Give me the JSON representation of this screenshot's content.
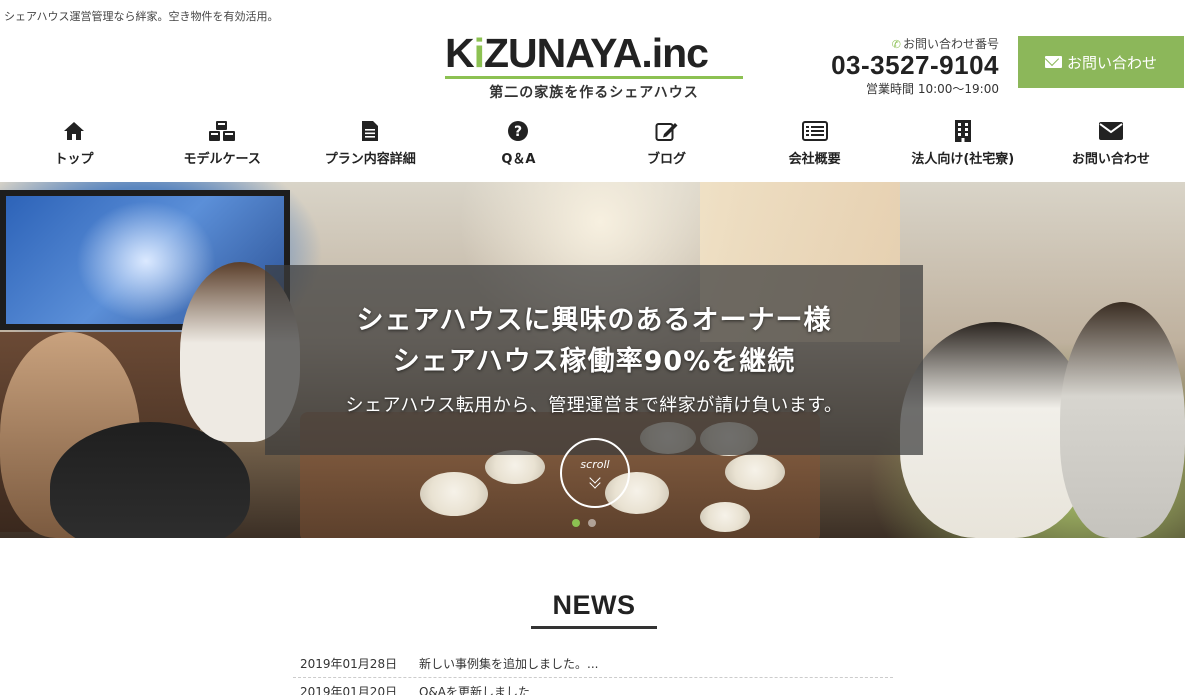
{
  "header": {
    "tagline": "シェアハウス運営管理なら絆家。空き物件を有効活用。",
    "logo_text_pre": "K",
    "logo_text_accent": "i",
    "logo_text_post": "ZUNAYA.inc",
    "logo_subtitle": "第二の家族を作るシェアハウス",
    "contact_label": "お問い合わせ番号",
    "phone": "03-3527-9104",
    "hours": "営業時間 10:00〜19:00",
    "cta_label": "お問い合わせ",
    "brand_color": "#8cb75a"
  },
  "nav": {
    "items": [
      {
        "label": "トップ",
        "icon": "home-icon"
      },
      {
        "label": "モデルケース",
        "icon": "cubes-icon"
      },
      {
        "label": "プラン内容詳細",
        "icon": "document-icon"
      },
      {
        "label": "Q＆A",
        "icon": "question-circle-icon"
      },
      {
        "label": "ブログ",
        "icon": "edit-icon"
      },
      {
        "label": "会社概要",
        "icon": "list-card-icon"
      },
      {
        "label": "法人向け(社宅寮)",
        "icon": "building-icon"
      },
      {
        "label": "お問い合わせ",
        "icon": "envelope-icon"
      }
    ]
  },
  "hero": {
    "title_line1": "シェアハウスに興味のあるオーナー様",
    "title_line2": "シェアハウス稼働率90%を継続",
    "subtitle": "シェアハウス転用から、管理運営まで絆家が請け負います。",
    "scroll_label": "scroll",
    "slides": 2,
    "active_slide": 1
  },
  "news": {
    "heading": "NEWS",
    "items": [
      {
        "date": "2019年01月28日",
        "text": "新しい事例集を追加しました。..."
      },
      {
        "date": "2019年01月20日",
        "text": "Q&Aを更新しました"
      }
    ]
  }
}
